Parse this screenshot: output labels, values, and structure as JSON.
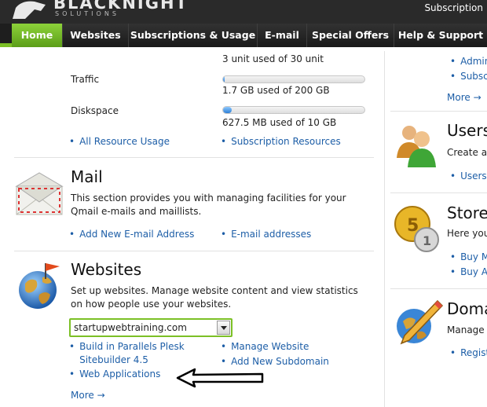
{
  "brand": {
    "name": "BLACKNIGHT",
    "tagline": "SOLUTIONS"
  },
  "top_link": "Subscription",
  "nav": {
    "tabs": [
      {
        "label": "Home",
        "active": true
      },
      {
        "label": "Websites"
      },
      {
        "label": "Subscriptions & Usage"
      },
      {
        "label": "E-mail"
      },
      {
        "label": "Special Offers"
      },
      {
        "label": "Help & Support"
      }
    ]
  },
  "resources": {
    "partial_value": "3 unit used of 30 unit",
    "traffic": {
      "label": "Traffic",
      "value": "1.7 GB used of 200 GB",
      "fraction": 0.0085
    },
    "diskspace": {
      "label": "Diskspace",
      "value": "627.5 MB used of 10 GB",
      "fraction": 0.06
    },
    "links": [
      "All Resource Usage",
      "Subscription Resources"
    ]
  },
  "mail": {
    "title": "Mail",
    "desc": "This section provides you with managing facilities for your Qmail e-mails and maillists.",
    "links": [
      "Add New E-mail Address",
      "E-mail addresses"
    ]
  },
  "websites": {
    "title": "Websites",
    "desc": "Set up websites. Manage website content and view statistics on how people use your websites.",
    "selected_domain": "startupwebtraining.com",
    "links_left": [
      "Build in Parallels Plesk Sitebuilder 4.5",
      "Web Applications"
    ],
    "links_right": [
      "Manage Website",
      "Add New Subdomain"
    ],
    "more": "More →"
  },
  "sidebar": {
    "top_links": [
      "Admins",
      "Subscr"
    ],
    "more": "More →",
    "users": {
      "title": "Users",
      "desc": "Create an",
      "links": [
        "Users"
      ]
    },
    "store": {
      "title": "Store",
      "desc": "Here you",
      "links": [
        "Buy Mo",
        "Buy Ad"
      ]
    },
    "domains": {
      "title": "Doma",
      "desc": "Manage y",
      "links": [
        "Registe"
      ]
    }
  },
  "colors": {
    "accent": "#7cc026",
    "link": "#1d5ea7",
    "nav_bg": "#1e1e1e"
  }
}
